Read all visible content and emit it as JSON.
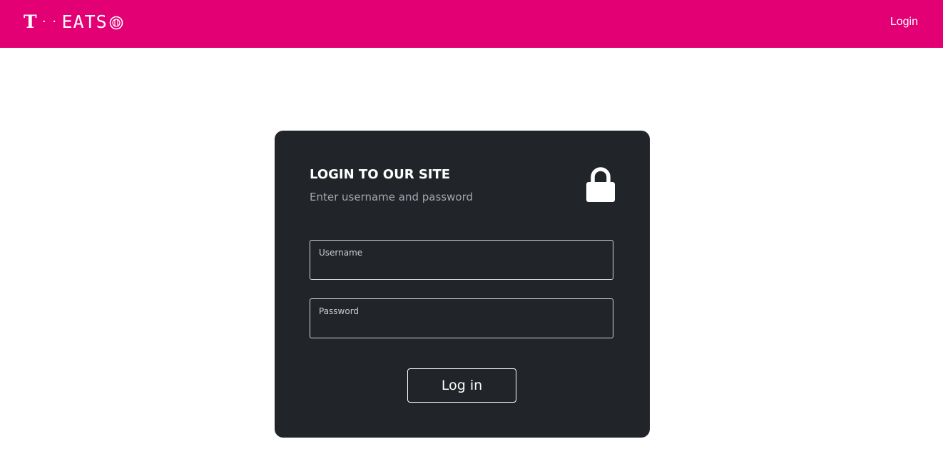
{
  "navbar": {
    "brand": {
      "t_logo": "T",
      "dots": "··",
      "name": "EATS",
      "icon": "fork-knife-plate-icon"
    },
    "login_link": "Login",
    "background_color": "#e20074"
  },
  "login_card": {
    "title": "LOGIN TO OUR SITE",
    "subtitle": "Enter username and password",
    "icon": "lock-icon",
    "background_color": "#212428",
    "username": {
      "label": "Username",
      "value": ""
    },
    "password": {
      "label": "Password",
      "value": ""
    },
    "submit_label": "Log in"
  }
}
